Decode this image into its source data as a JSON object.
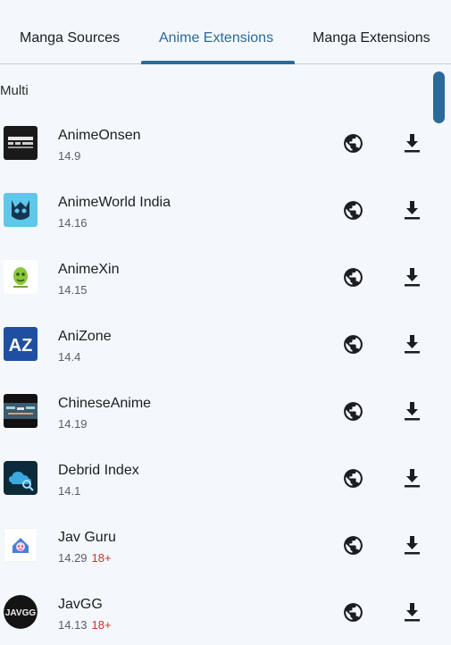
{
  "tabs": [
    {
      "label": "Manga Sources",
      "active": false
    },
    {
      "label": "Anime Extensions",
      "active": true
    },
    {
      "label": "Manga Extensions",
      "active": false
    }
  ],
  "section_header": "Multi",
  "extensions": [
    {
      "name": "AnimeOnsen",
      "version": "14.9",
      "nsfw": "",
      "icon": "animeonsen-icon"
    },
    {
      "name": "AnimeWorld India",
      "version": "14.16",
      "nsfw": "",
      "icon": "animeworld-india-icon"
    },
    {
      "name": "AnimeXin",
      "version": "14.15",
      "nsfw": "",
      "icon": "animexin-icon"
    },
    {
      "name": "AniZone",
      "version": "14.4",
      "nsfw": "",
      "icon": "anizone-icon"
    },
    {
      "name": "ChineseAnime",
      "version": "14.19",
      "nsfw": "",
      "icon": "chineseanime-icon"
    },
    {
      "name": "Debrid Index",
      "version": "14.1",
      "nsfw": "",
      "icon": "debrid-index-icon"
    },
    {
      "name": "Jav Guru",
      "version": "14.29",
      "nsfw": "18+",
      "icon": "jav-guru-icon"
    },
    {
      "name": "JavGG",
      "version": "14.13",
      "nsfw": "18+",
      "icon": "javgg-icon"
    }
  ],
  "icon_text": {
    "anizone": "AZ",
    "javgg": "JAVGG"
  },
  "colors": {
    "accent": "#2c6a9a",
    "nsfw": "#c0392b",
    "background": "#f4f7fb"
  }
}
